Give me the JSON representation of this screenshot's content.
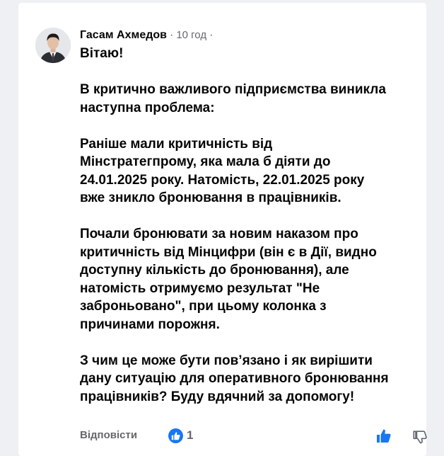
{
  "comment": {
    "author": "Гасам Ахмедов",
    "separator": "·",
    "time": "10 год",
    "time_suffix": "·",
    "paragraphs": [
      [
        "Вітаю!"
      ],
      [
        "В критично важливого підприємства виникла",
        "наступна проблема:"
      ],
      [
        "Раніше мали критичність від",
        "Мінстратегпрому, яка мала б діяти до",
        "24.01.2025 року. Натомість, 22.01.2025 року",
        "вже зникло бронювання в працівників."
      ],
      [
        "Почали бронювати за новим наказом про",
        "критичність від Мінцифри (він є в Дії, видно",
        "доступну кількість до бронювання), але",
        "натомість отримуємо результат \"Не",
        "заброньовано\", при цьому колонка з",
        "причинами порожня."
      ],
      [
        "З чим це може бути пов’язано і як вирішити",
        "дану ситуацію для оперативного бронювання",
        "працівників? Буду вдячний за допомогу!"
      ]
    ]
  },
  "footer": {
    "reply_label": "Відповісти",
    "reaction_icon": "like-icon",
    "reaction_count": "1",
    "like_icon": "thumbs-up-icon",
    "dislike_icon": "thumbs-down-icon"
  },
  "colors": {
    "brand_blue": "#1877f2",
    "secondary_text": "#65676b",
    "primary_text": "#050505"
  }
}
